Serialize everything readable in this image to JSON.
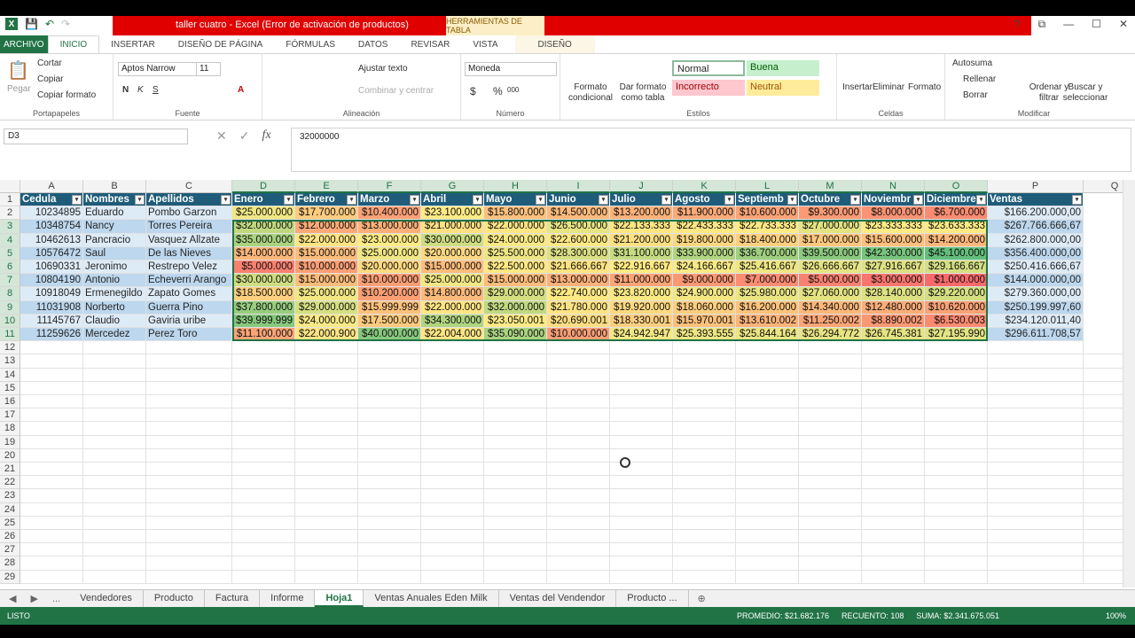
{
  "window": {
    "title": "taller cuatro -  Excel (Error de activación de productos)",
    "tool_context": "HERRAMIENTAS DE TABLA",
    "ctrl_help": "?",
    "ctrl_restore": "⧉",
    "ctrl_min": "—",
    "ctrl_max": "☐",
    "ctrl_close": "✕"
  },
  "menu": {
    "file": "ARCHIVO",
    "tabs": [
      "INICIO",
      "INSERTAR",
      "DISEÑO DE PÁGINA",
      "FÓRMULAS",
      "DATOS",
      "REVISAR",
      "VISTA"
    ],
    "design": "DISEÑO"
  },
  "ribbon": {
    "clipboard": {
      "paste": "Pegar",
      "cut": "Cortar",
      "copy": "Copiar",
      "format_painter": "Copiar formato",
      "label": "Portapapeles"
    },
    "font": {
      "name": "Aptos Narrow",
      "size": "11",
      "bold": "N",
      "italic": "K",
      "underline": "S",
      "label": "Fuente"
    },
    "alignment": {
      "wrap": "Ajustar texto",
      "merge": "Combinar y centrar",
      "label": "Alineación"
    },
    "number": {
      "format": "Moneda",
      "currency": "$",
      "percent": "%",
      "thousands": "000",
      "label": "Número"
    },
    "styles": {
      "cond_format": "Formato condicional",
      "table_format": "Dar formato como tabla",
      "normal": "Normal",
      "good": "Buena",
      "bad": "Incorrecto",
      "neutral": "Neutral",
      "label": "Estilos"
    },
    "cells": {
      "insert": "Insertar",
      "delete": "Eliminar",
      "format": "Formato",
      "label": "Celdas"
    },
    "editing": {
      "autosum": "Autosuma",
      "fill": "Rellenar",
      "clear": "Borrar",
      "sort": "Ordenar y filtrar",
      "find": "Buscar y seleccionar",
      "label": "Modificar"
    }
  },
  "formula_bar": {
    "name_box": "D3",
    "fx": "fx",
    "value": "32000000"
  },
  "grid": {
    "columns": [
      "A",
      "B",
      "C",
      "D",
      "E",
      "F",
      "G",
      "H",
      "I",
      "J",
      "K",
      "L",
      "M",
      "N",
      "O",
      "P",
      "Q"
    ],
    "headers": [
      "Cedula",
      "Nombres",
      "Apellidos",
      "Enero",
      "Febrero",
      "Marzo",
      "Abril",
      "Mayo",
      "Junio",
      "Julio",
      "Agosto",
      "Septiemb",
      "Octubre",
      "Noviembr",
      "Diciembre",
      "Ventas"
    ],
    "rows": [
      [
        "10234895",
        "Eduardo",
        "Pombo Garzon",
        "$25.000.000",
        "$17.700.000",
        "$10.400.000",
        "$23.100.000",
        "$15.800.000",
        "$14.500.000",
        "$13.200.000",
        "$11.900.000",
        "$10.600.000",
        "$9.300.000",
        "$8.000.000",
        "$6.700.000",
        "$166.200.000,00"
      ],
      [
        "10348754",
        "Nancy",
        "Torres Pereira",
        "$32.000.000",
        "$12.000.000",
        "$13.000.000",
        "$21.000.000",
        "$22.000.000",
        "$26.500.000",
        "$22.133.333",
        "$22.433.333",
        "$22.733.333",
        "$27.000.000",
        "$23.333.333",
        "$23.633.333",
        "$267.766.666,67"
      ],
      [
        "10462613",
        "Pancracio",
        "Vasquez Allzate",
        "$35.000.000",
        "$22.000.000",
        "$23.000.000",
        "$30.000.000",
        "$24.000.000",
        "$22.600.000",
        "$21.200.000",
        "$19.800.000",
        "$18.400.000",
        "$17.000.000",
        "$15.600.000",
        "$14.200.000",
        "$262.800.000,00"
      ],
      [
        "10576472",
        "Saul",
        "De las Nieves",
        "$14.000.000",
        "$15.000.000",
        "$25.000.000",
        "$20.000.000",
        "$25.500.000",
        "$28.300.000",
        "$31.100.000",
        "$33.900.000",
        "$36.700.000",
        "$39.500.000",
        "$42.300.000",
        "$45.100.000",
        "$356.400.000,00"
      ],
      [
        "10690331",
        "Jeronimo",
        "Restrepo Velez",
        "$5.000.000",
        "$10.000.000",
        "$20.000.000",
        "$15.000.000",
        "$22.500.000",
        "$21.666.667",
        "$22.916.667",
        "$24.166.667",
        "$25.416.667",
        "$26.666.667",
        "$27.916.667",
        "$29.166.667",
        "$250.416.666,67"
      ],
      [
        "10804190",
        "Antonio",
        "Echeverri Arango",
        "$30.000.000",
        "$15.000.000",
        "$10.000.000",
        "$25.000.000",
        "$15.000.000",
        "$13.000.000",
        "$11.000.000",
        "$9.000.000",
        "$7.000.000",
        "$5.000.000",
        "$3.000.000",
        "$1.000.000",
        "$144.000.000,00"
      ],
      [
        "10918049",
        "Ermenegildo",
        "Zapato Gomes",
        "$18.500.000",
        "$25.000.000",
        "$10.200.000",
        "$14.800.000",
        "$29.000.000",
        "$22.740.000",
        "$23.820.000",
        "$24.900.000",
        "$25.980.000",
        "$27.060.000",
        "$28.140.000",
        "$29.220.000",
        "$279.360.000,00"
      ],
      [
        "11031908",
        "Norberto",
        "Guerra Pino",
        "$37.800.000",
        "$29.000.000",
        "$15.999.999",
        "$22.000.000",
        "$32.000.000",
        "$21.780.000",
        "$19.920.000",
        "$18.060.000",
        "$16.200.000",
        "$14.340.000",
        "$12.480.000",
        "$10.620.000",
        "$250.199.997,60"
      ],
      [
        "11145767",
        "Claudio",
        "Gaviria uribe",
        "$39.999.999",
        "$24.000.000",
        "$17.500.000",
        "$34.300.000",
        "$23.050.001",
        "$20.690.001",
        "$18.330.001",
        "$15.970.001",
        "$13.610.002",
        "$11.250.002",
        "$8.890.002",
        "$6.530.003",
        "$234.120.011,40"
      ],
      [
        "11259626",
        "Mercedez",
        "Perez Toro",
        "$11.100.000",
        "$22.000.900",
        "$40.000.000",
        "$22.004.000",
        "$35.090.000",
        "$10.000.000",
        "$24.942.947",
        "$25.393.555",
        "$25.844.164",
        "$26.294.772",
        "$26.745.381",
        "$27.195.990",
        "$296.611.708,57"
      ]
    ],
    "extra_rows": [
      12,
      13,
      14,
      15,
      16,
      17,
      18,
      19,
      20,
      21,
      22,
      23,
      24,
      25,
      26,
      27,
      28,
      29
    ]
  },
  "sheets": {
    "nav_prev": "◀",
    "nav_next": "▶",
    "more": "...",
    "tabs": [
      "Vendedores",
      "Producto",
      "Factura",
      "Informe",
      "Hoja1",
      "Ventas Anuales Eden Milk",
      "Ventas del Vendendor",
      "Producto ..."
    ],
    "active": "Hoja1",
    "add": "⊕"
  },
  "status": {
    "mode": "LISTO",
    "avg": "PROMEDIO: $21.682.176",
    "count": "RECUENTO: 108",
    "sum": "SUMA: $2.341.675.051",
    "zoom": "100%"
  }
}
